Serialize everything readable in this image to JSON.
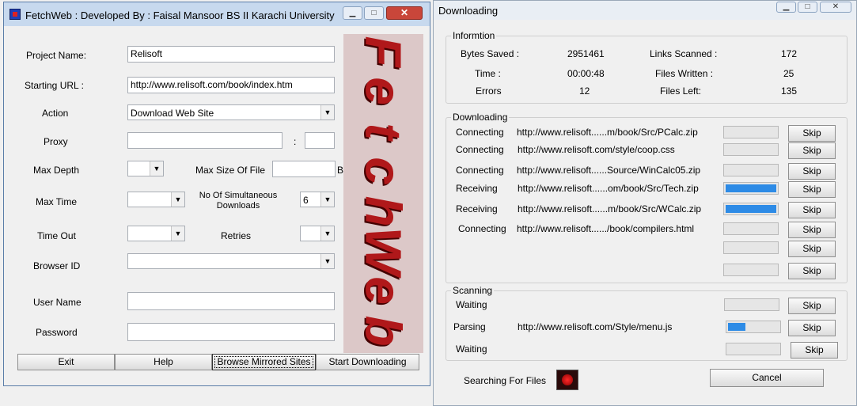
{
  "fetch_window": {
    "title": "FetchWeb : Developed By : Faisal Mansoor BS II Karachi University",
    "logo_text": "FetchWeb",
    "project_name_label": "Project Name:",
    "project_name_value": "Relisoft",
    "starting_url_label": "Starting URL :",
    "starting_url_value": "http://www.relisoft.com/book/index.htm",
    "action_label": "Action",
    "action_value": "Download Web Site",
    "proxy_label": "Proxy",
    "proxy_value": "",
    "proxy_sep": ":",
    "port_value": "",
    "max_depth_label": "Max Depth",
    "max_depth_value": "",
    "max_size_label": "Max Size Of File",
    "max_size_value": "",
    "max_size_unit": "B",
    "max_time_label": "Max Time",
    "max_time_value": "",
    "simultaneous_label": "No Of Simultaneous Downloads",
    "simultaneous_value": "6",
    "time_out_label": "Time Out",
    "time_out_value": "",
    "retries_label": "Retries",
    "retries_value": "",
    "browser_id_label": "Browser ID",
    "browser_id_value": "",
    "user_name_label": "User Name",
    "user_name_value": "",
    "password_label": "Password",
    "password_value": "",
    "buttons": {
      "exit": "Exit",
      "help": "Help",
      "browse": "Browse Mirrored Sites",
      "start": "Start Downloading"
    }
  },
  "download_window": {
    "title": "Downloading",
    "info": {
      "group_label": "Informtion",
      "bytes_saved_label": "Bytes Saved :",
      "bytes_saved": "2951461",
      "links_scanned_label": "Links Scanned :",
      "links_scanned": "172",
      "time_label": "Time :",
      "time": "00:00:48",
      "files_written_label": "Files Written :",
      "files_written": "25",
      "errors_label": "Errors",
      "errors": "12",
      "files_left_label": "Files Left:",
      "files_left": "135"
    },
    "downloading": {
      "group_label": "Downloading",
      "rows": [
        {
          "status": "Connecting",
          "url": "http://www.relisoft......m/book/Src/PCalc.zip",
          "progress": 0,
          "skip": "Skip"
        },
        {
          "status": "Connecting",
          "url": "http://www.relisoft.com/style/coop.css",
          "progress": 0,
          "skip": "Skip"
        },
        {
          "status": "Connecting",
          "url": "http://www.relisoft......Source/WinCalc05.zip",
          "progress": 0,
          "skip": "Skip"
        },
        {
          "status": "Receiving",
          "url": "http://www.relisoft......om/book/Src/Tech.zip",
          "progress": 1.0,
          "skip": "Skip"
        },
        {
          "status": "Receiving",
          "url": "http://www.relisoft......m/book/Src/WCalc.zip",
          "progress": 1.0,
          "skip": "Skip"
        },
        {
          "status": "Connecting",
          "url": "http://www.relisoft....../book/compilers.html",
          "progress": 0,
          "skip": "Skip"
        },
        {
          "status": "",
          "url": "",
          "progress": 0,
          "skip": "Skip"
        },
        {
          "status": "",
          "url": "",
          "progress": 0,
          "skip": "Skip"
        }
      ]
    },
    "scanning": {
      "group_label": "Scanning",
      "rows": [
        {
          "status": "Waiting",
          "url": "",
          "progress": 0,
          "skip": "Skip"
        },
        {
          "status": "Parsing",
          "url": "http://www.relisoft.com/Style/menu.js",
          "progress": 0.35,
          "skip": "Skip"
        },
        {
          "status": "Waiting",
          "url": "",
          "progress": 0,
          "skip": "Skip"
        }
      ]
    },
    "searching_label": "Searching For Files",
    "cancel_label": "Cancel"
  },
  "colors": {
    "progress_fill": "#2d8be6",
    "logo_text": "#b0181a",
    "titlebar": "#c7d9ee"
  }
}
